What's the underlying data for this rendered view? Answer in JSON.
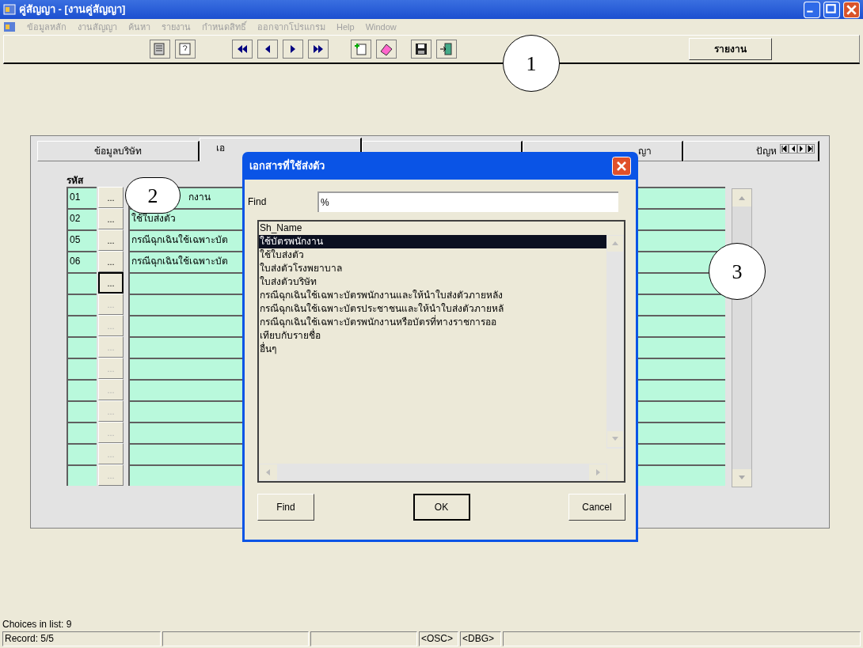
{
  "window": {
    "title": "คู่สัญญา - [งานคู่สัญญา]"
  },
  "menu": [
    {
      "label": "ข้อมูลหลัก",
      "disabled": true
    },
    {
      "label": "งานสัญญา",
      "disabled": true
    },
    {
      "label": "ค้นหา",
      "disabled": true
    },
    {
      "label": "รายงาน",
      "disabled": true
    },
    {
      "label": "กำหนดสิทธิ์",
      "disabled": true
    },
    {
      "label": "ออกจากโปรแกรม",
      "disabled": true
    },
    {
      "label": "Help",
      "disabled": true
    },
    {
      "label": "Window",
      "disabled": true
    }
  ],
  "toolbar": {
    "report_button": "รายงาน"
  },
  "tabs": [
    {
      "label": "ข้อมูลบริษัท",
      "selected": false
    },
    {
      "label": "เอ",
      "selected": true
    },
    {
      "selected": false
    },
    {
      "label": "ญา",
      "selected": false
    },
    {
      "label": "ปัญห",
      "selected": false
    }
  ],
  "grid": {
    "code_header": "รหัส",
    "rows": [
      {
        "code": "01",
        "button": "...",
        "focused": false,
        "disabled": false,
        "name": "กงาน"
      },
      {
        "code": "02",
        "button": "...",
        "focused": false,
        "disabled": false,
        "name": "ใช้ใบส่งตัว"
      },
      {
        "code": "05",
        "button": "...",
        "focused": false,
        "disabled": false,
        "name": "กรณีฉุกเฉินใช้เฉพาะบัต"
      },
      {
        "code": "06",
        "button": "...",
        "focused": false,
        "disabled": false,
        "name": "กรณีฉุกเฉินใช้เฉพาะบัต"
      },
      {
        "button": "...",
        "focused": true,
        "disabled": false
      },
      {
        "button": "...",
        "focused": false,
        "disabled": true
      },
      {
        "button": "...",
        "focused": false,
        "disabled": true
      },
      {
        "button": "...",
        "focused": false,
        "disabled": true
      },
      {
        "button": "...",
        "focused": false,
        "disabled": true
      },
      {
        "button": "...",
        "focused": false,
        "disabled": true
      },
      {
        "button": "...",
        "focused": false,
        "disabled": true
      },
      {
        "button": "...",
        "focused": false,
        "disabled": true
      },
      {
        "button": "...",
        "focused": false,
        "disabled": true
      },
      {
        "button": "...",
        "focused": false,
        "disabled": true
      }
    ]
  },
  "dialog": {
    "title": "เอกสารที่ใช้ส่งตัว",
    "find_label": "Find",
    "find_value": "%",
    "list_header": "Sh_Name",
    "items": [
      {
        "text": "ใช้บัตรพนักงาน",
        "selected": true
      },
      {
        "text": "ใช้ใบส่งตัว",
        "selected": false
      },
      {
        "text": "ใบส่งตัวโรงพยาบาล",
        "selected": false
      },
      {
        "text": "ใบส่งตัวบริษัท",
        "selected": false
      },
      {
        "text": "กรณีฉุกเฉินใช้เฉพาะบัตรพนักงานและให้นำใบส่งตัวภายหลัง",
        "selected": false
      },
      {
        "text": "กรณีฉุกเฉินใช้เฉพาะบัตรประชาชนและให้นำใบส่งตัวภายหลั",
        "selected": false
      },
      {
        "text": "กรณีฉุกเฉินใช้เฉพาะบัตรพนักงานหรือบัตรที่ทางราชการออ",
        "selected": false
      },
      {
        "text": "เทียบกับรายชื่อ",
        "selected": false
      },
      {
        "text": "อื่นๆ",
        "selected": false
      }
    ],
    "buttons": [
      {
        "label": "Find",
        "default": false
      },
      {
        "label": "OK",
        "default": true
      },
      {
        "label": "Cancel",
        "default": false
      }
    ]
  },
  "callouts": [
    "1",
    "2",
    "3"
  ],
  "status_bar": {
    "message": "Choices in list: 9",
    "panels": [
      {
        "text": "Record: 5/5"
      },
      {
        "text": "<OSC>"
      },
      {
        "text": "<DBG>"
      }
    ]
  }
}
